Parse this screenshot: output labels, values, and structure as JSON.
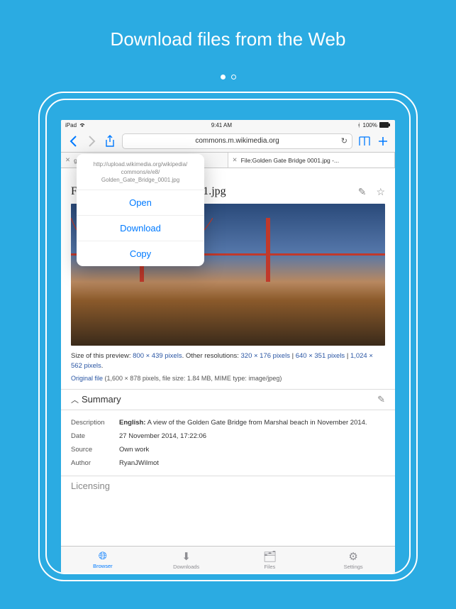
{
  "hero_title": "Download files from the Web",
  "statusbar": {
    "device": "iPad",
    "time": "9:41 AM",
    "battery": "100%"
  },
  "navbar": {
    "url": "commons.m.wikimedia.org"
  },
  "tabs": [
    {
      "label": "g News, U.S., World, Weather,..."
    },
    {
      "label": "File:Golden Gate Bridge 0001.jpg -..."
    }
  ],
  "popover": {
    "url_line1": "http://upload.wikimedia.org/wikipedia/",
    "url_line2": "commons/e/e8/",
    "url_line3": "Golden_Gate_Bridge_0001.jpg",
    "open": "Open",
    "download": "Download",
    "copy": "Copy"
  },
  "page": {
    "title": "File:Golden Gate Bridge 0001.jpg",
    "size_prefix": "Size of this preview: ",
    "size_main": "800 × 439 pixels",
    "other_prefix": ". Other resolutions: ",
    "res1": "320 × 176 pixels",
    "sep": " | ",
    "res2": "640 × 351 pixels",
    "res3": "1,024 × 562 pixels",
    "period": ".",
    "original": "Original file",
    "original_meta": " (1,600 × 878 pixels, file size: 1.84 MB, MIME type: image/jpeg)",
    "summary_label": "Summary",
    "licensing_label": "Licensing",
    "desc_label": "Description",
    "desc_lang": "English:",
    "desc_text": " A view of the Golden Gate Bridge from Marshal beach in November 2014.",
    "date_label": "Date",
    "date_val": "27 November 2014, 17:22:06",
    "source_label": "Source",
    "source_val": "Own work",
    "author_label": "Author",
    "author_val": "RyanJWilmot"
  },
  "tabbar": {
    "browser": "Browser",
    "downloads": "Downloads",
    "files": "Files",
    "settings": "Settings"
  }
}
